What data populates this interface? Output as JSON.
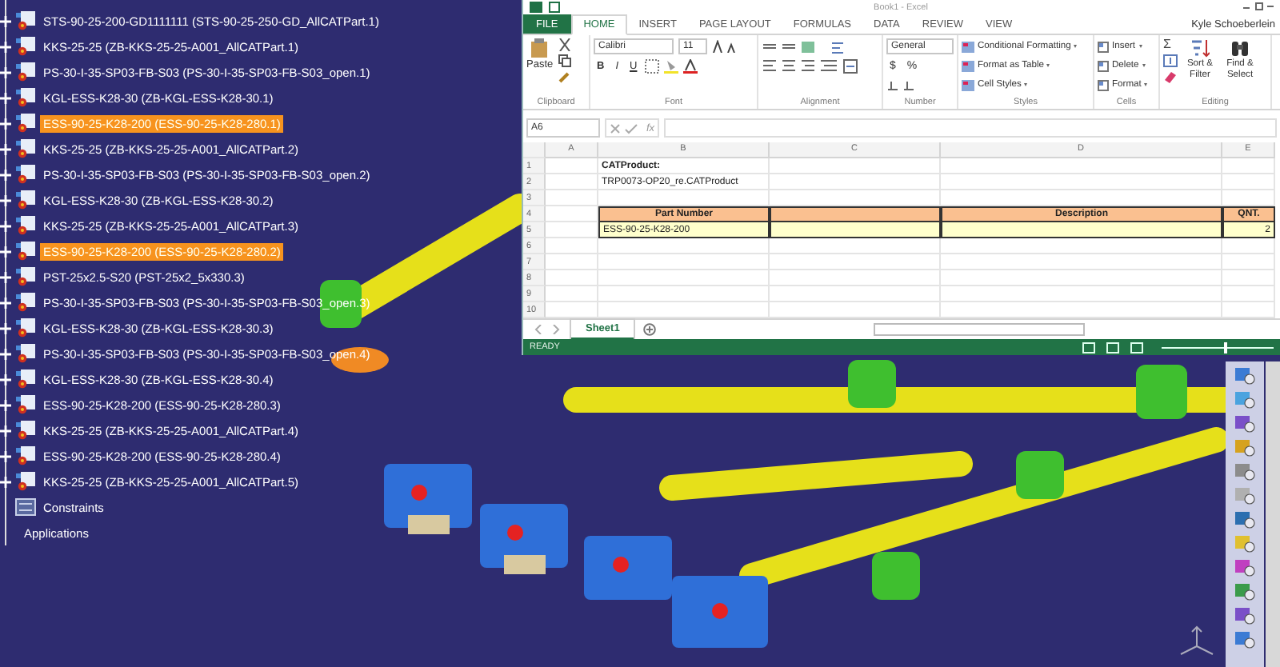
{
  "tree": {
    "items": [
      {
        "kind": "part",
        "label": "STS-90-25-200-GD1111111 (STS-90-25-250-GD_AllCATPart.1)",
        "selected": false
      },
      {
        "kind": "part",
        "label": "KKS-25-25 (ZB-KKS-25-25-A001_AllCATPart.1)",
        "selected": false
      },
      {
        "kind": "part",
        "label": "PS-30-I-35-SP03-FB-S03 (PS-30-I-35-SP03-FB-S03_open.1)",
        "selected": false
      },
      {
        "kind": "part",
        "label": "KGL-ESS-K28-30 (ZB-KGL-ESS-K28-30.1)",
        "selected": false
      },
      {
        "kind": "part",
        "label": "ESS-90-25-K28-200 (ESS-90-25-K28-280.1)",
        "selected": true
      },
      {
        "kind": "part",
        "label": "KKS-25-25 (ZB-KKS-25-25-A001_AllCATPart.2)",
        "selected": false
      },
      {
        "kind": "part",
        "label": "PS-30-I-35-SP03-FB-S03 (PS-30-I-35-SP03-FB-S03_open.2)",
        "selected": false
      },
      {
        "kind": "part",
        "label": "KGL-ESS-K28-30 (ZB-KGL-ESS-K28-30.2)",
        "selected": false
      },
      {
        "kind": "part",
        "label": "KKS-25-25 (ZB-KKS-25-25-A001_AllCATPart.3)",
        "selected": false
      },
      {
        "kind": "part",
        "label": "ESS-90-25-K28-200 (ESS-90-25-K28-280.2)",
        "selected": true
      },
      {
        "kind": "part",
        "label": "PST-25x2.5-S20 (PST-25x2_5x330.3)",
        "selected": false
      },
      {
        "kind": "part",
        "label": "PS-30-I-35-SP03-FB-S03 (PS-30-I-35-SP03-FB-S03_open.3)",
        "selected": false
      },
      {
        "kind": "part",
        "label": "KGL-ESS-K28-30 (ZB-KGL-ESS-K28-30.3)",
        "selected": false
      },
      {
        "kind": "part",
        "label": "PS-30-I-35-SP03-FB-S03 (PS-30-I-35-SP03-FB-S03_open.4)",
        "selected": false
      },
      {
        "kind": "part",
        "label": "KGL-ESS-K28-30 (ZB-KGL-ESS-K28-30.4)",
        "selected": false
      },
      {
        "kind": "part",
        "label": "ESS-90-25-K28-200 (ESS-90-25-K28-280.3)",
        "selected": false
      },
      {
        "kind": "part",
        "label": "KKS-25-25 (ZB-KKS-25-25-A001_AllCATPart.4)",
        "selected": false
      },
      {
        "kind": "part",
        "label": "ESS-90-25-K28-200 (ESS-90-25-K28-280.4)",
        "selected": false
      },
      {
        "kind": "part",
        "label": "KKS-25-25 (ZB-KKS-25-25-A001_AllCATPart.5)",
        "selected": false
      },
      {
        "kind": "constraints",
        "label": "Constraints",
        "selected": false
      },
      {
        "kind": "applications",
        "label": "Applications",
        "selected": false
      }
    ]
  },
  "excel": {
    "title": "Book1 - Excel",
    "file_tab": "FILE",
    "tabs": [
      {
        "label": "HOME",
        "selected": true
      },
      {
        "label": "INSERT",
        "selected": false
      },
      {
        "label": "PAGE LAYOUT",
        "selected": false
      },
      {
        "label": "FORMULAS",
        "selected": false
      },
      {
        "label": "DATA",
        "selected": false
      },
      {
        "label": "REVIEW",
        "selected": false
      },
      {
        "label": "VIEW",
        "selected": false
      }
    ],
    "user": "Kyle Schoeberlein",
    "ribbon": {
      "clipboard": {
        "paste": "Paste",
        "label": "Clipboard"
      },
      "font": {
        "family": "Calibri",
        "size": "11",
        "style_buttons": [
          "B",
          "I",
          "U"
        ],
        "label": "Font"
      },
      "alignment": {
        "label": "Alignment"
      },
      "number": {
        "format": "General",
        "symbols": [
          "$",
          "%"
        ],
        "label": "Number"
      },
      "styles": {
        "buttons": [
          "Conditional Formatting",
          "Format as Table",
          "Cell Styles"
        ],
        "label": "Styles"
      },
      "cells": {
        "buttons": [
          "Insert",
          "Delete",
          "Format"
        ],
        "label": "Cells"
      },
      "editing": {
        "autosum": "Σ",
        "buttons": [
          "Sort & Filter",
          "Find & Select"
        ],
        "label": "Editing"
      }
    },
    "formula_bar": {
      "name_box": "A6",
      "fx": "fx"
    },
    "columns": [
      "A",
      "B",
      "C",
      "D",
      "E"
    ],
    "rows": [
      {
        "number": "1",
        "kind": "title",
        "cells": [
          "",
          "CATProduct:"
        ]
      },
      {
        "number": "2",
        "kind": "plain",
        "cells": [
          "",
          "TRP0073-OP20_re.CATProduct"
        ]
      },
      {
        "number": "3",
        "kind": "plain",
        "cells": []
      },
      {
        "number": "4",
        "kind": "header",
        "cells": [
          "",
          "Part Number",
          "",
          "Description",
          "QNT."
        ]
      },
      {
        "number": "5",
        "kind": "data",
        "cells": [
          "",
          "ESS-90-25-K28-200",
          "",
          "",
          "2"
        ]
      },
      {
        "number": "6",
        "kind": "plain",
        "cells": []
      },
      {
        "number": "7",
        "kind": "plain",
        "cells": []
      },
      {
        "number": "8",
        "kind": "plain",
        "cells": []
      },
      {
        "number": "9",
        "kind": "plain",
        "cells": []
      },
      {
        "number": "10",
        "kind": "plain",
        "cells": []
      }
    ],
    "sheets": [
      {
        "label": "Sheet1",
        "selected": true
      }
    ],
    "status": "READY",
    "zoom": {
      "level": 0.55
    }
  }
}
